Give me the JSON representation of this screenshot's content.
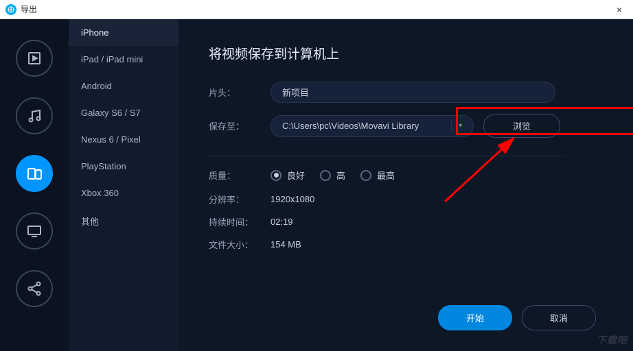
{
  "window": {
    "title": "导出",
    "close_icon": "×"
  },
  "sidebar_icons": [
    {
      "name": "video-icon",
      "active": false
    },
    {
      "name": "music-icon",
      "active": false
    },
    {
      "name": "device-icon",
      "active": true
    },
    {
      "name": "monitor-icon",
      "active": false
    },
    {
      "name": "share-icon",
      "active": false
    }
  ],
  "devices": {
    "items": [
      "iPhone",
      "iPad / iPad mini",
      "Android",
      "Galaxy S6 / S7",
      "Nexus 6 / Pixel",
      "PlayStation",
      "Xbox 360",
      "其他"
    ],
    "selected_index": 0
  },
  "main": {
    "heading": "将视频保存到计算机上",
    "labels": {
      "title_field": "片头：",
      "save_to": "保存至：",
      "quality": "质量：",
      "resolution": "分辨率：",
      "duration": "持续时间：",
      "filesize": "文件大小："
    },
    "title_value": "新项目",
    "save_path": "C:\\Users\\pc\\Videos\\Movavi Library",
    "browse_label": "浏览",
    "quality_options": [
      "良好",
      "高",
      "最高"
    ],
    "quality_selected": 0,
    "resolution": "1920x1080",
    "duration": "02:19",
    "filesize": "154 MB"
  },
  "footer": {
    "start": "开始",
    "cancel": "取消"
  },
  "watermark": "下载吧"
}
